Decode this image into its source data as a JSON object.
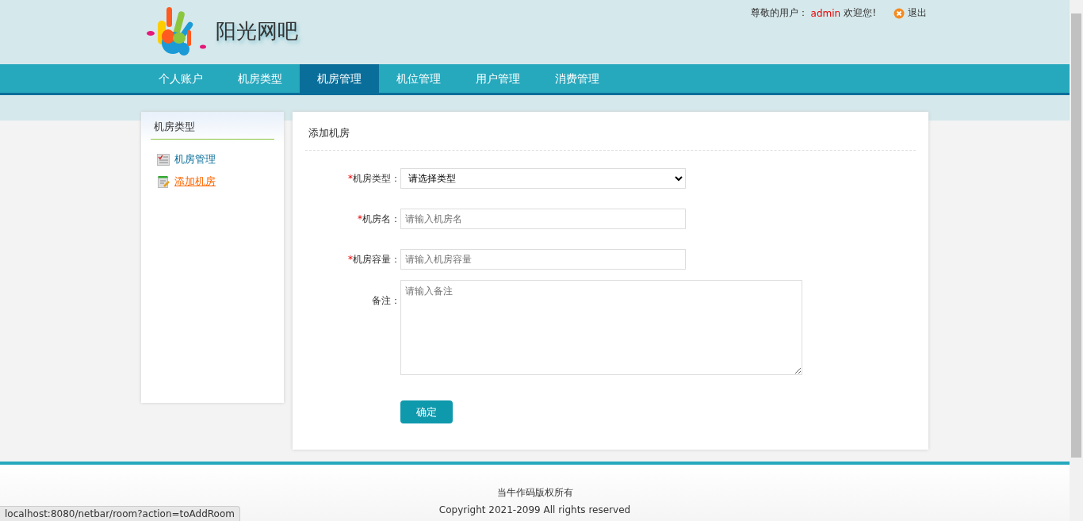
{
  "header": {
    "site_title": "阳光网吧",
    "greeting": "尊敬的用户：",
    "username": "admin",
    "welcome": "欢迎您!",
    "logout": "退出"
  },
  "nav": [
    {
      "label": "个人账户",
      "selected": false
    },
    {
      "label": "机房类型",
      "selected": false
    },
    {
      "label": "机房管理",
      "selected": true
    },
    {
      "label": "机位管理",
      "selected": false
    },
    {
      "label": "用户管理",
      "selected": false
    },
    {
      "label": "消费管理",
      "selected": false
    }
  ],
  "sidebar": {
    "title": "机房类型",
    "items": [
      {
        "label": "机房管理",
        "kind": "list",
        "selected": false
      },
      {
        "label": "添加机房",
        "kind": "add",
        "selected": true
      }
    ]
  },
  "panel": {
    "title": "添加机房",
    "fields": [
      {
        "required_mark": "*",
        "label": "机房类型：",
        "kind": "select",
        "value": "请选择类型"
      },
      {
        "required_mark": "*",
        "label": "机房名：",
        "kind": "input",
        "placeholder": "请输入机房名"
      },
      {
        "required_mark": "*",
        "label": "机房容量：",
        "kind": "input",
        "placeholder": "请输入机房容量"
      },
      {
        "label": "备注：",
        "kind": "textarea",
        "placeholder": "请输入备注"
      }
    ],
    "submit": "确定"
  },
  "footer": {
    "lines": [
      "当牛作码版权所有",
      "Copyright 2021-2099 All rights reserved"
    ]
  },
  "status_url": "localhost:8080/netbar/room?action=toAddRoom"
}
